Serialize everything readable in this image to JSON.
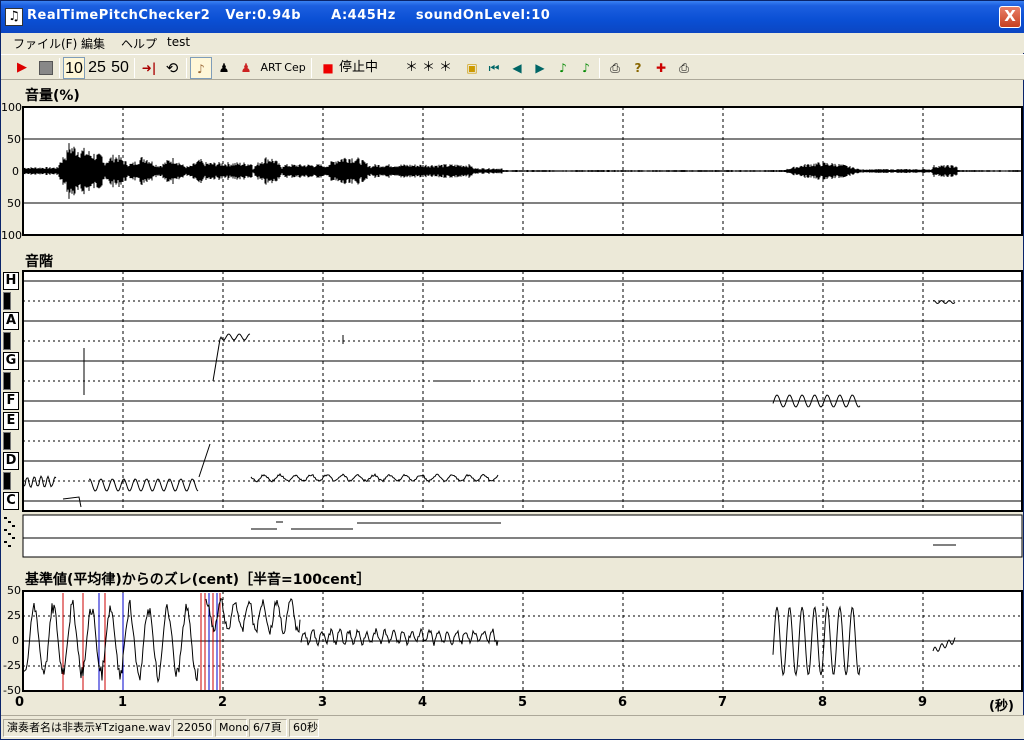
{
  "window": {
    "title": "RealTimePitchChecker2   Ver:0.94b      A:445Hz    soundOnLevel:10",
    "close_label": "X"
  },
  "menu": [
    "ファイル(F)",
    "編集",
    "ヘルプ",
    "test"
  ],
  "toolbar": {
    "zoom_buttons": [
      "10",
      "25",
      "50"
    ],
    "status_text": "停止中",
    "stars": "＊＊＊",
    "art_label": "ART",
    "cep_label": "Cep"
  },
  "volume_panel": {
    "title": "音量(%)",
    "y_labels": [
      "100",
      "50",
      "0",
      "50",
      "100"
    ]
  },
  "scale_panel": {
    "title": "音階",
    "notes": [
      "H",
      "A",
      "G",
      "F",
      "E",
      "D",
      "C"
    ]
  },
  "cent_panel": {
    "title": "基準値(平均律)からのズレ(cent)［半音=100cent］",
    "y_labels": [
      "50",
      "25",
      "0",
      "-25",
      "-50"
    ],
    "x_labels": [
      "0",
      "1",
      "2",
      "3",
      "4",
      "5",
      "6",
      "7",
      "8",
      "9"
    ],
    "x_unit": "(秒)"
  },
  "statusbar": {
    "file": "演奏者名は非表示¥Tzigane.wav",
    "rate": "22050",
    "channels": "Mono",
    "page": "6/7頁",
    "duration": "60秒"
  },
  "colors": {
    "title_bar": "#0a4fd4",
    "grid": "#000000",
    "trace": "#000000",
    "marker_red": "#cc0000",
    "marker_blue": "#0000cc"
  }
}
